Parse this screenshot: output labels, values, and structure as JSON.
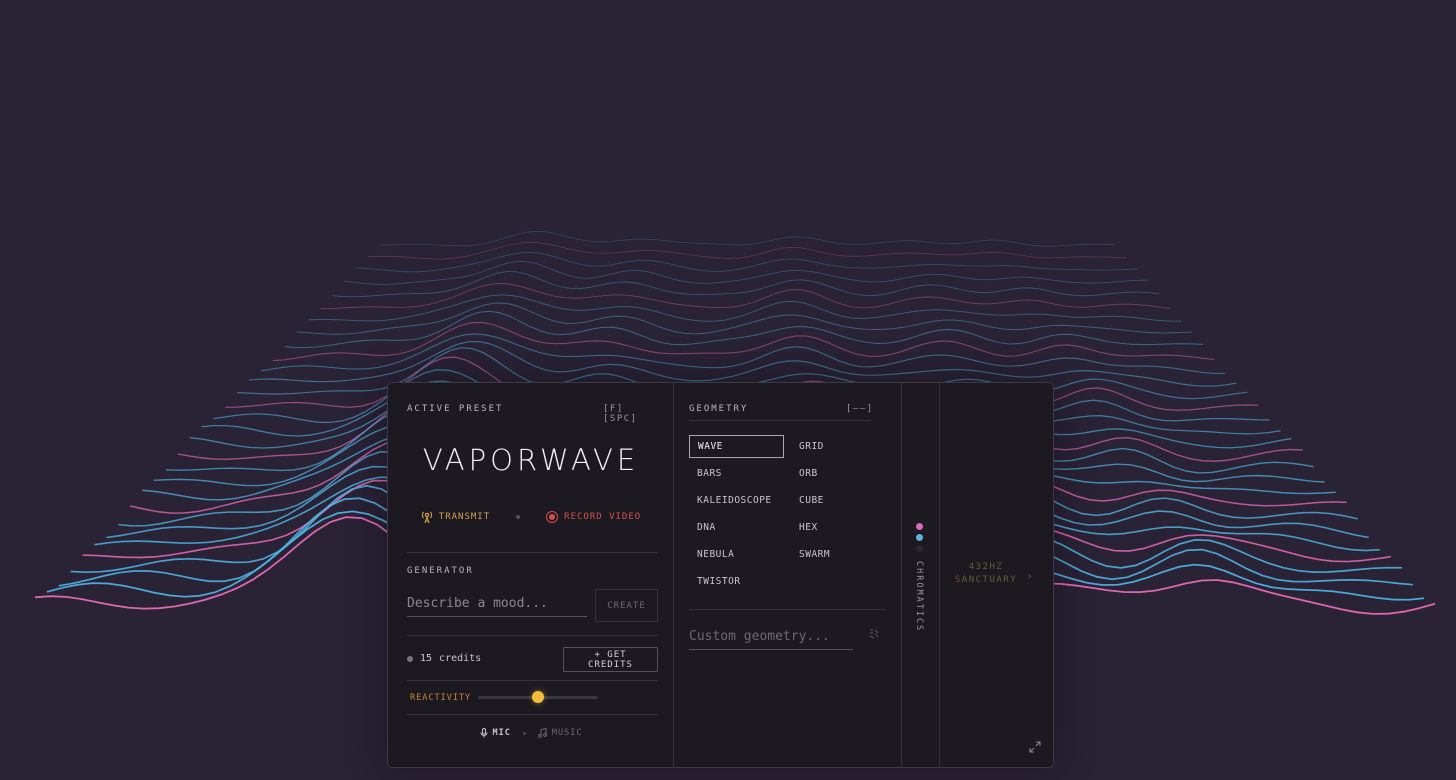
{
  "colors": {
    "background": "#2a2235",
    "panel": "#1c1a20",
    "wave_pink": "#e86bb8",
    "wave_blue": "#4fb4e6",
    "accent_gold": "#f4bf3d",
    "record_red": "#d45050"
  },
  "preset": {
    "header": "ACTIVE PRESET",
    "key_f": "[F]",
    "key_space": "[SPC]",
    "name": "VAPORWAVE",
    "transmit_label": "TRANSMIT",
    "transmit_icon": "broadcast-tower-icon",
    "record_label": "RECORD VIDEO",
    "record_icon": "record-icon"
  },
  "generator": {
    "header": "GENERATOR",
    "placeholder": "Describe a mood...",
    "create_label": "CREATE",
    "credits_count": "15",
    "credits_unit": "credits",
    "get_credits_label": "+ GET CREDITS",
    "reactivity_label": "REACTIVITY",
    "reactivity_value": 0.5
  },
  "audio_source": {
    "mic_label": "MIC",
    "mic_icon": "microphone-icon",
    "music_label": "MUSIC",
    "music_icon": "music-note-icon",
    "selected": "MIC"
  },
  "geometry": {
    "header": "GEOMETRY",
    "key_hint": "[——]",
    "items": [
      "WAVE",
      "GRID",
      "BARS",
      "ORB",
      "KALEIDOSCOPE",
      "CUBE",
      "DNA",
      "HEX",
      "NEBULA",
      "SWARM",
      "TWISTOR"
    ],
    "selected": "WAVE",
    "custom_placeholder": "Custom geometry...",
    "custom_icon": "shapes-icon"
  },
  "chromatics": {
    "label": "CHROMATICS",
    "swatches": [
      "#d76bc0",
      "#5fb3e0",
      "#2a2830"
    ]
  },
  "side": {
    "line1": "432HZ",
    "line2": "SANCTUARY",
    "chevron_icon": "chevron-right-icon",
    "expand_icon": "expand-icon"
  }
}
